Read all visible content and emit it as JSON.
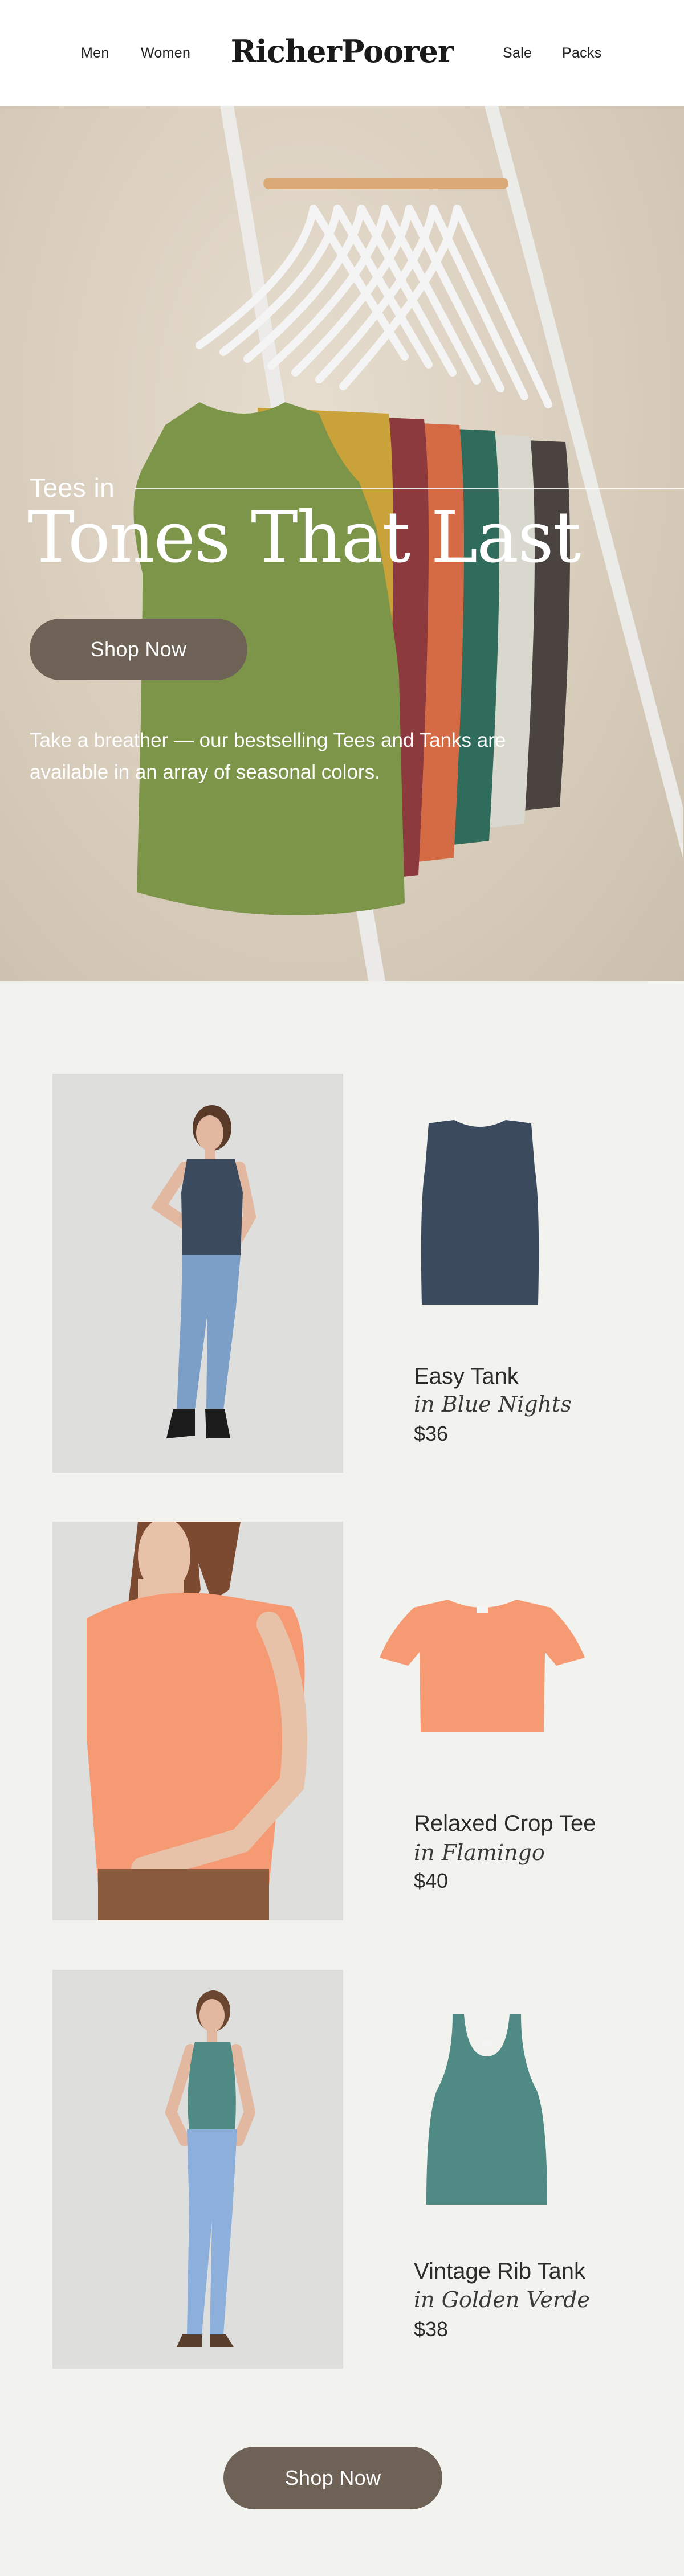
{
  "header": {
    "nav_left": [
      "Men",
      "Women"
    ],
    "logo": "RicherPoorer",
    "nav_right": [
      "Sale",
      "Packs"
    ]
  },
  "hero": {
    "eyebrow": "Tees in",
    "title": "Tones That Last",
    "cta": "Shop Now",
    "description": "Take a breather — our bestselling Tees and Tanks are available in an array of seasonal colors.",
    "shirt_colors": [
      "#7c9548",
      "#c9a23a",
      "#8c3a3e",
      "#d56b45",
      "#2f6c5c",
      "#d9d8cf",
      "#4b4340"
    ]
  },
  "products": [
    {
      "name": "Easy Tank",
      "color": "in Blue Nights",
      "price": "$36",
      "swatch": "#3c4a5e"
    },
    {
      "name": "Relaxed Crop Tee",
      "color": "in Flamingo",
      "price": "$40",
      "swatch": "#f59a72"
    },
    {
      "name": "Vintage Rib Tank",
      "color": "in Golden Verde",
      "price": "$38",
      "swatch": "#4f8a84"
    }
  ],
  "footer": {
    "cta": "Shop Now"
  },
  "colors": {
    "button": "#6e6257",
    "page_bg": "#f2f2ee",
    "header_bg": "#ffffff"
  }
}
